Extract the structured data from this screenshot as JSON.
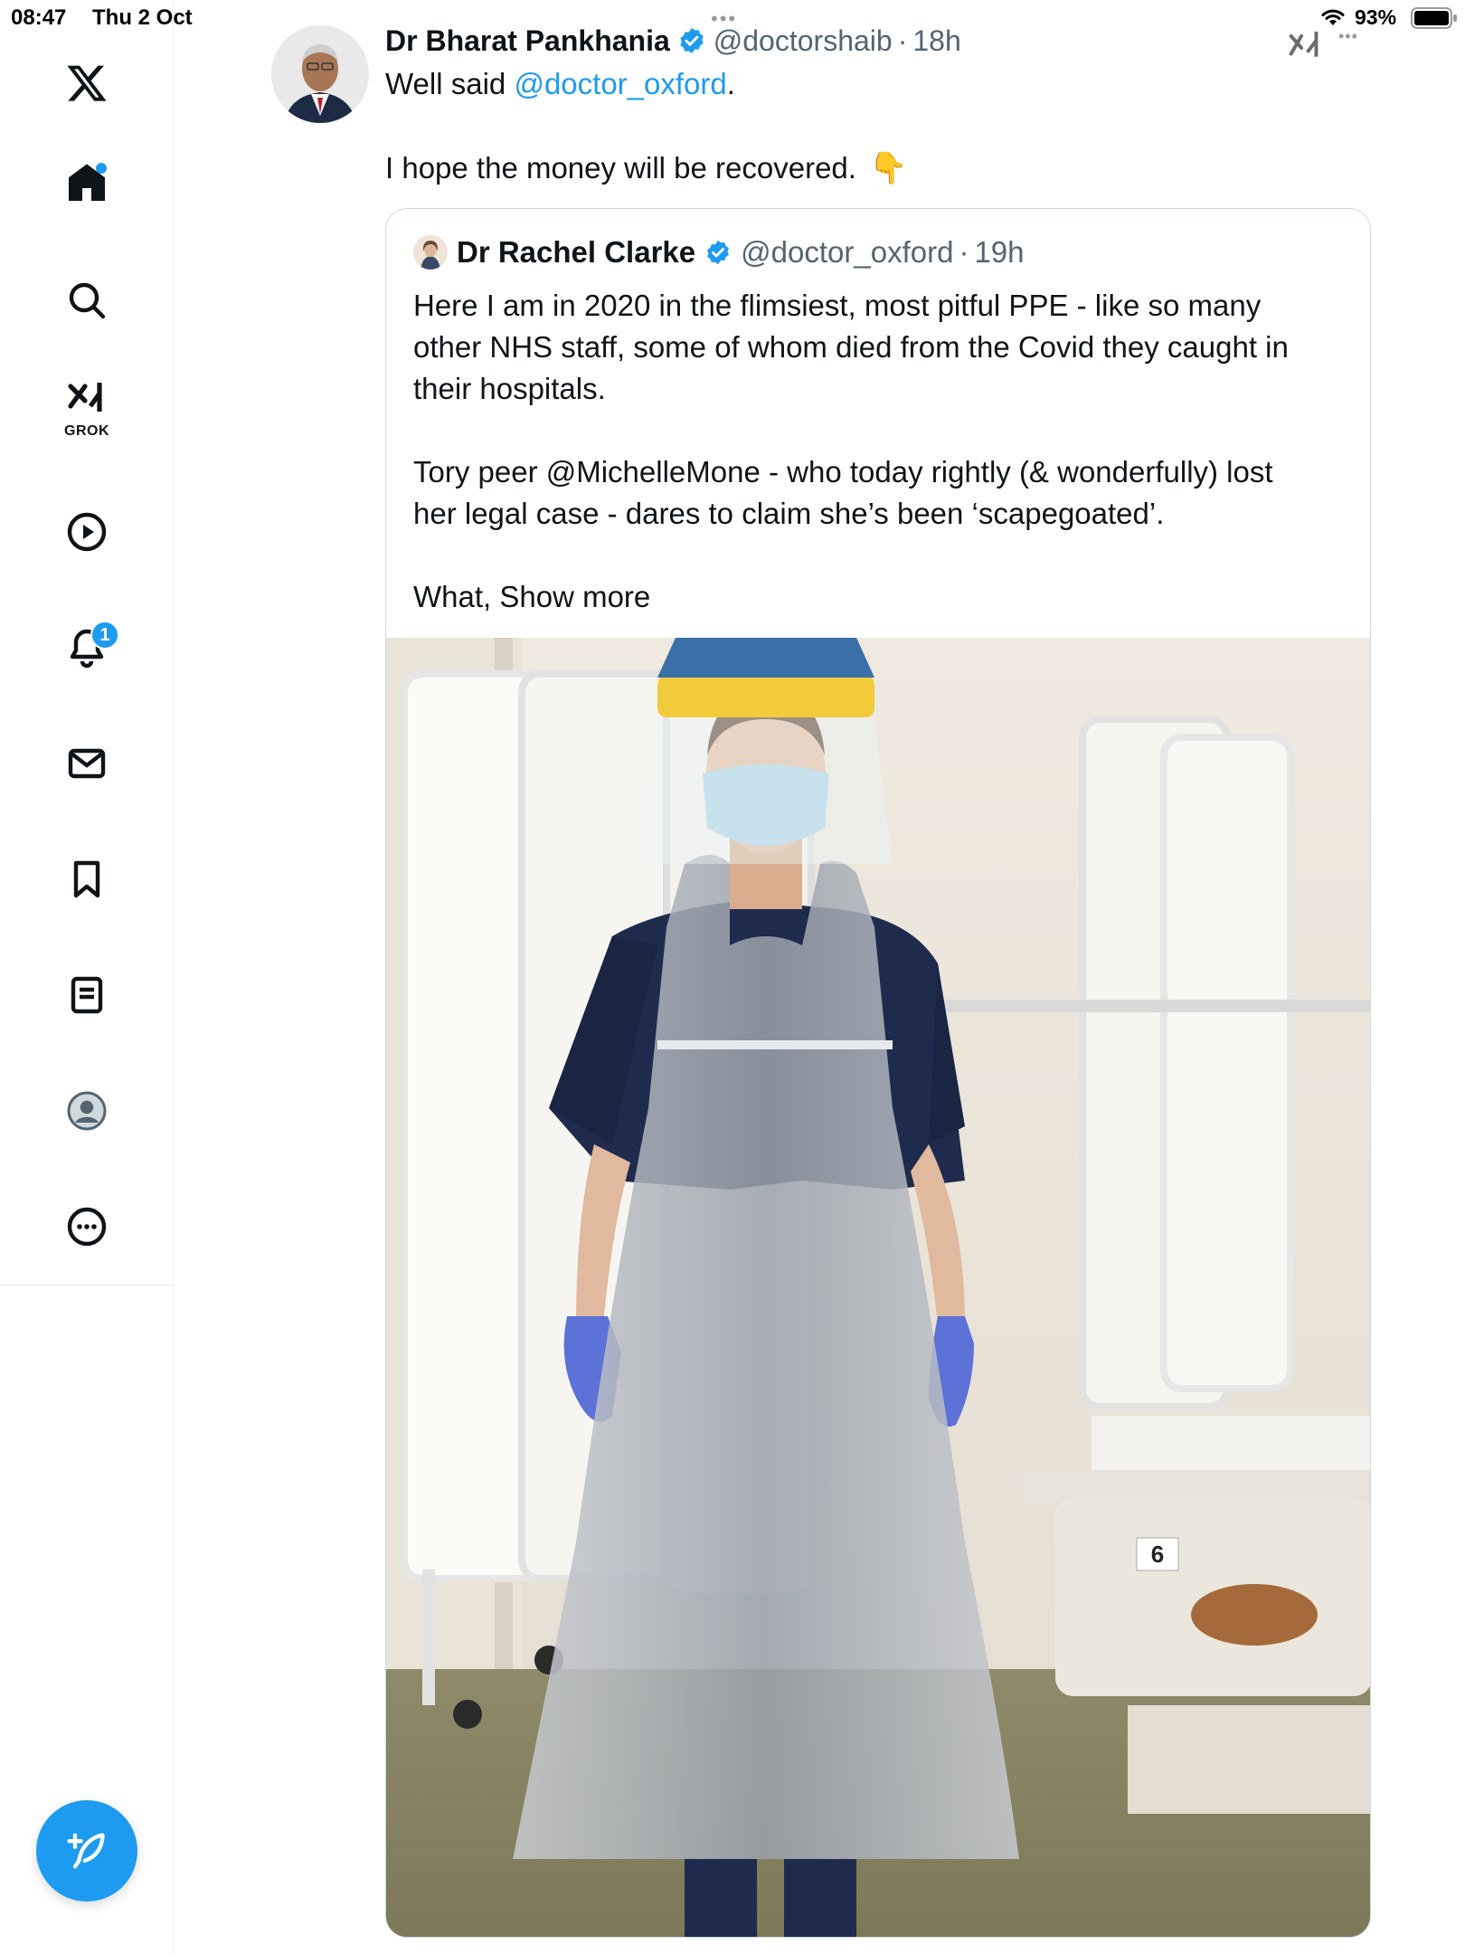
{
  "status_bar": {
    "time": "08:47",
    "date": "Thu 2 Oct",
    "battery": "93%"
  },
  "sidebar": {
    "items": [
      {
        "name": "x-logo",
        "icon": "x-logo-icon"
      },
      {
        "name": "home",
        "icon": "home-icon"
      },
      {
        "name": "explore",
        "icon": "search-icon"
      },
      {
        "name": "grok",
        "icon": "grok-icon",
        "label": "GROK"
      },
      {
        "name": "video",
        "icon": "play-icon"
      },
      {
        "name": "notifications",
        "icon": "bell-icon",
        "badge": "1"
      },
      {
        "name": "messages",
        "icon": "mail-icon"
      },
      {
        "name": "bookmarks",
        "icon": "bookmark-icon"
      },
      {
        "name": "articles",
        "icon": "article-icon"
      },
      {
        "name": "profile",
        "icon": "avatar-icon"
      },
      {
        "name": "more",
        "icon": "more-icon"
      }
    ]
  },
  "tweet": {
    "author_name": "Dr Bharat Pankhania",
    "handle": "@doctorshaib",
    "separator": "·",
    "timestamp": "18h",
    "line1_prefix": "Well said ",
    "line1_mention": "@doctor_oxford",
    "line1_suffix": ".",
    "line2": "I hope the money will be recovered.",
    "emoji": "👇"
  },
  "quote": {
    "author_name": "Dr Rachel Clarke",
    "handle": "@doctor_oxford",
    "separator": "·",
    "timestamp": "19h",
    "para1_lines": [
      "Here I am in 2020 in the flimsiest, most pitful PPE - like so many",
      "other NHS staff, some of whom died from the Covid they caught in",
      "their hospitals."
    ],
    "para2_lines": [
      "Tory peer @MichelleMone - who today rightly (& wonderfully) lost",
      "her legal case - dares to claim she’s been ‘scapegoated’."
    ],
    "para3_prefix": "What, ",
    "show_more": "Show more",
    "photo_bed_number": "6"
  },
  "colors": {
    "accent": "#1d9bf0",
    "text": "#0f1419",
    "secondary": "#536471",
    "border": "#cfd9de"
  }
}
